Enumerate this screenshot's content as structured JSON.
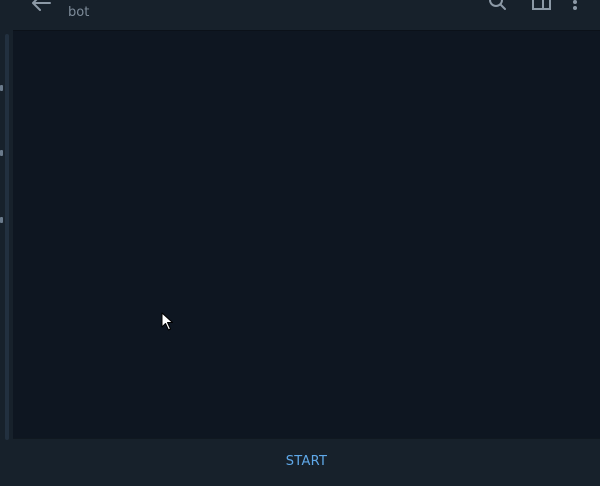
{
  "header": {
    "subtitle": "bot",
    "icons": [
      "back-arrow-icon",
      "search-icon",
      "sidebar-panel-icon",
      "more-vertical-icon"
    ]
  },
  "footer": {
    "start_label": "START"
  },
  "colors": {
    "background": "#0e1621",
    "panel": "#17212b",
    "accent": "#5fa8e8",
    "muted_text": "#7d8b99"
  }
}
